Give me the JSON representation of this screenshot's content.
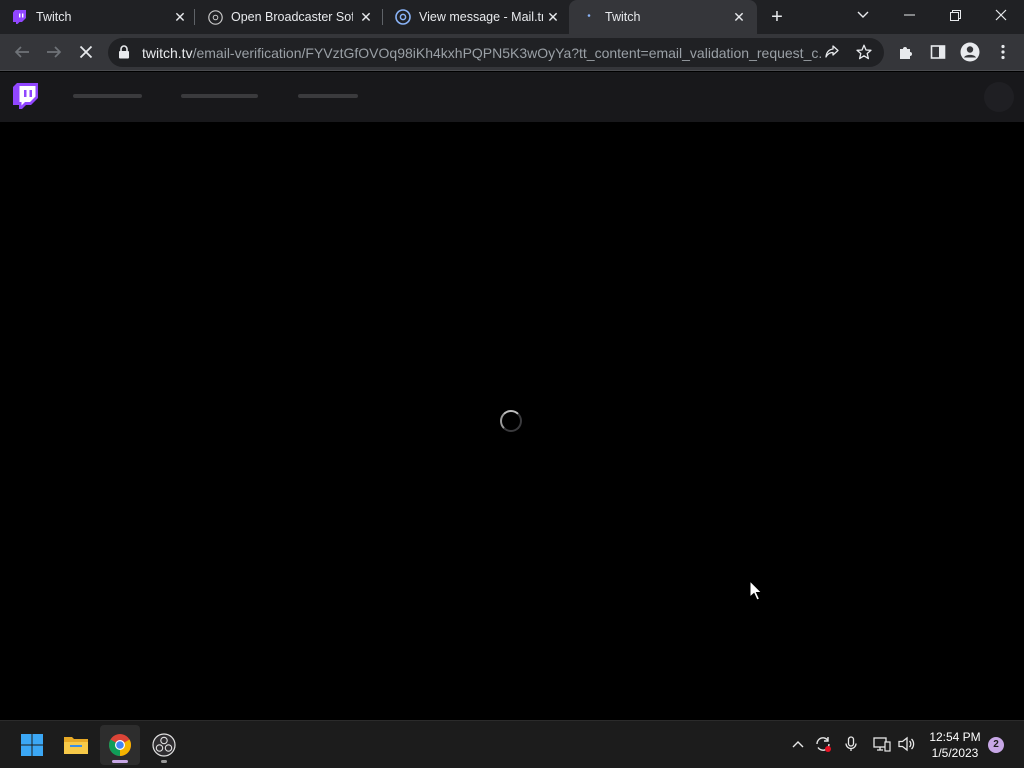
{
  "browser": {
    "tabs": [
      {
        "title": "Twitch",
        "favicon": "twitch-icon",
        "active": false
      },
      {
        "title": "Open Broadcaster Softw",
        "favicon": "obs-icon",
        "active": false
      },
      {
        "title": "View message - Mail.tm",
        "favicon": "at-sign-icon",
        "active": false
      },
      {
        "title": "Twitch",
        "favicon": "loading-dot-icon",
        "active": true
      }
    ],
    "address_bar": {
      "host": "twitch.tv",
      "path": "/email-verification/FYVztGfOVOq98iKh4kxhPQPN5K3wOyYa?tt_content=email_validation_request_c..."
    }
  },
  "twitch": {
    "brand_color": "#9146ff"
  },
  "taskbar": {
    "clock": {
      "time": "12:54 PM",
      "date": "1/5/2023"
    },
    "notification_count": "2"
  }
}
